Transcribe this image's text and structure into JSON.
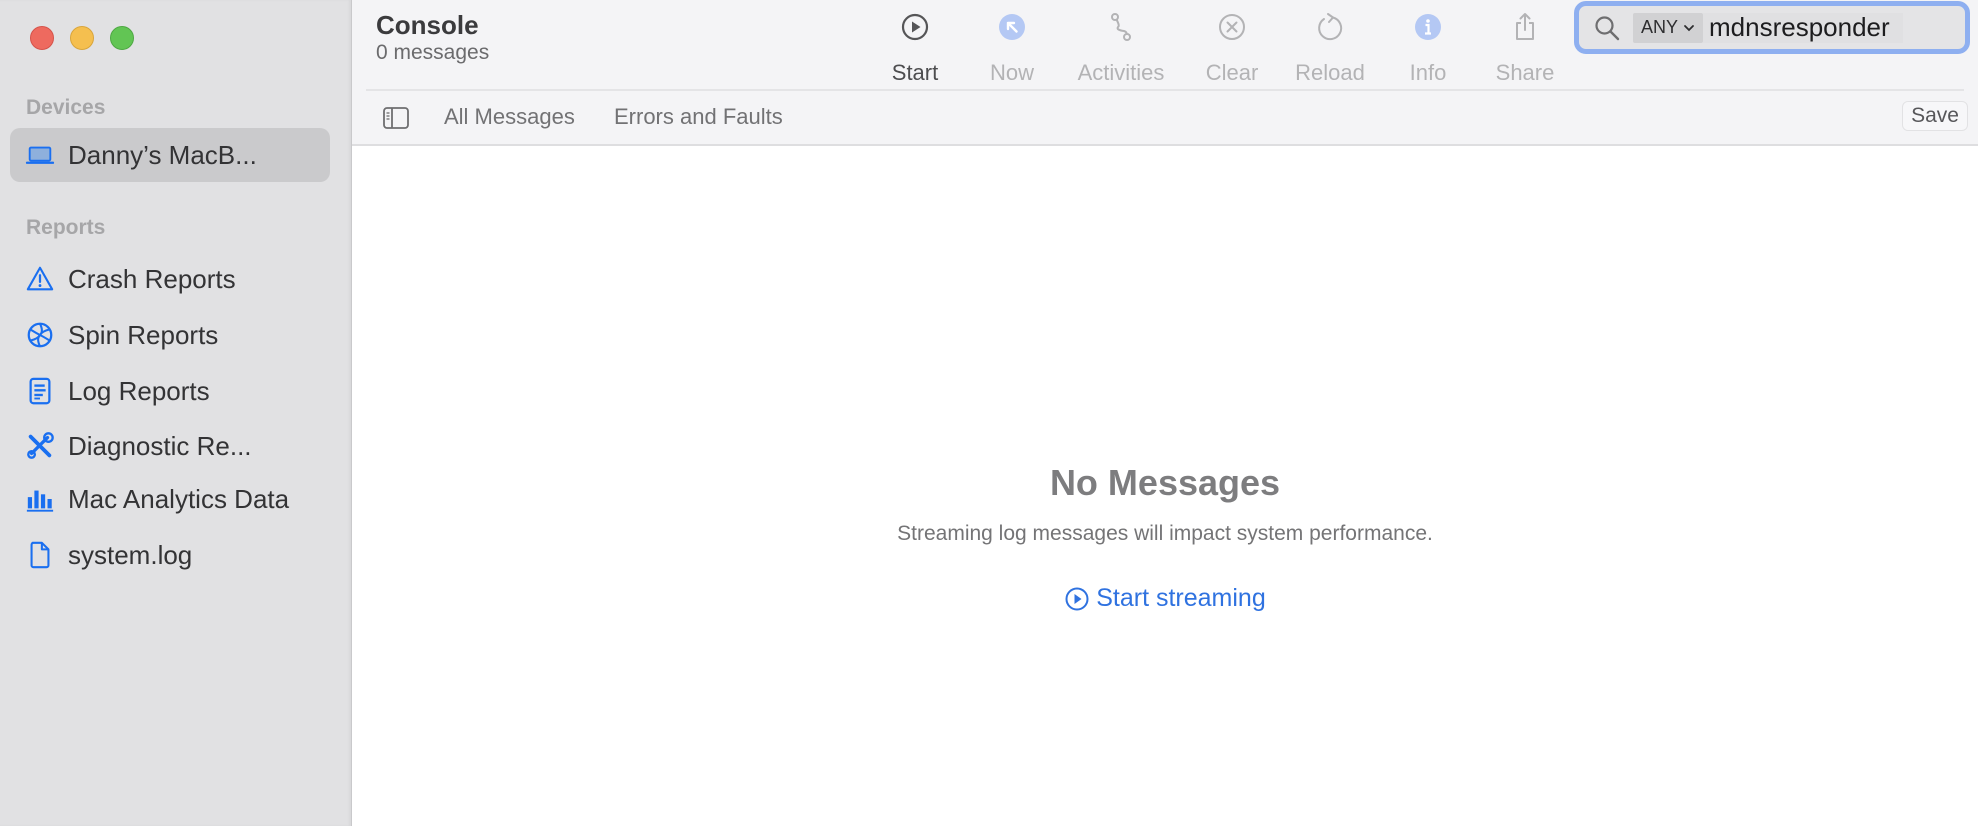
{
  "window": {
    "traffic_lights": [
      "close",
      "minimize",
      "zoom"
    ]
  },
  "sidebar": {
    "devices_label": "Devices",
    "devices": [
      {
        "label": "Danny’s MacB...",
        "icon": "laptop-icon",
        "selected": true
      }
    ],
    "reports_label": "Reports",
    "reports": [
      {
        "label": "Crash Reports",
        "icon": "warning-triangle-icon"
      },
      {
        "label": "Spin Reports",
        "icon": "spin-aperture-icon"
      },
      {
        "label": "Log Reports",
        "icon": "document-lines-icon"
      },
      {
        "label": "Diagnostic Re...",
        "icon": "wrench-screwdriver-icon"
      },
      {
        "label": "Mac Analytics Data",
        "icon": "bar-chart-icon"
      },
      {
        "label": "system.log",
        "icon": "document-icon"
      }
    ]
  },
  "header": {
    "title": "Console",
    "subtitle": "0 messages"
  },
  "toolbar": {
    "items": [
      {
        "label": "Start",
        "icon": "play-circle-icon",
        "enabled": true
      },
      {
        "label": "Now",
        "icon": "now-arrow-icon",
        "enabled": false
      },
      {
        "label": "Activities",
        "icon": "activities-path-icon",
        "enabled": false
      },
      {
        "label": "Clear",
        "icon": "clear-circle-icon",
        "enabled": false
      },
      {
        "label": "Reload",
        "icon": "reload-icon",
        "enabled": false
      },
      {
        "label": "Info",
        "icon": "info-icon",
        "enabled": false
      },
      {
        "label": "Share",
        "icon": "share-icon",
        "enabled": false
      }
    ],
    "accent_disabled": "#b4c8f4",
    "focus_ring": "#8eaff0"
  },
  "search": {
    "scope": "ANY",
    "value": "mdnsresponder",
    "placeholder": "Search"
  },
  "filterbar": {
    "tabs": [
      "All Messages",
      "Errors and Faults"
    ],
    "save_label": "Save"
  },
  "content": {
    "empty_title": "No Messages",
    "empty_subtitle": "Streaming log messages will impact system performance.",
    "start_streaming_label": "Start streaming",
    "link_color": "#2f72e0"
  }
}
